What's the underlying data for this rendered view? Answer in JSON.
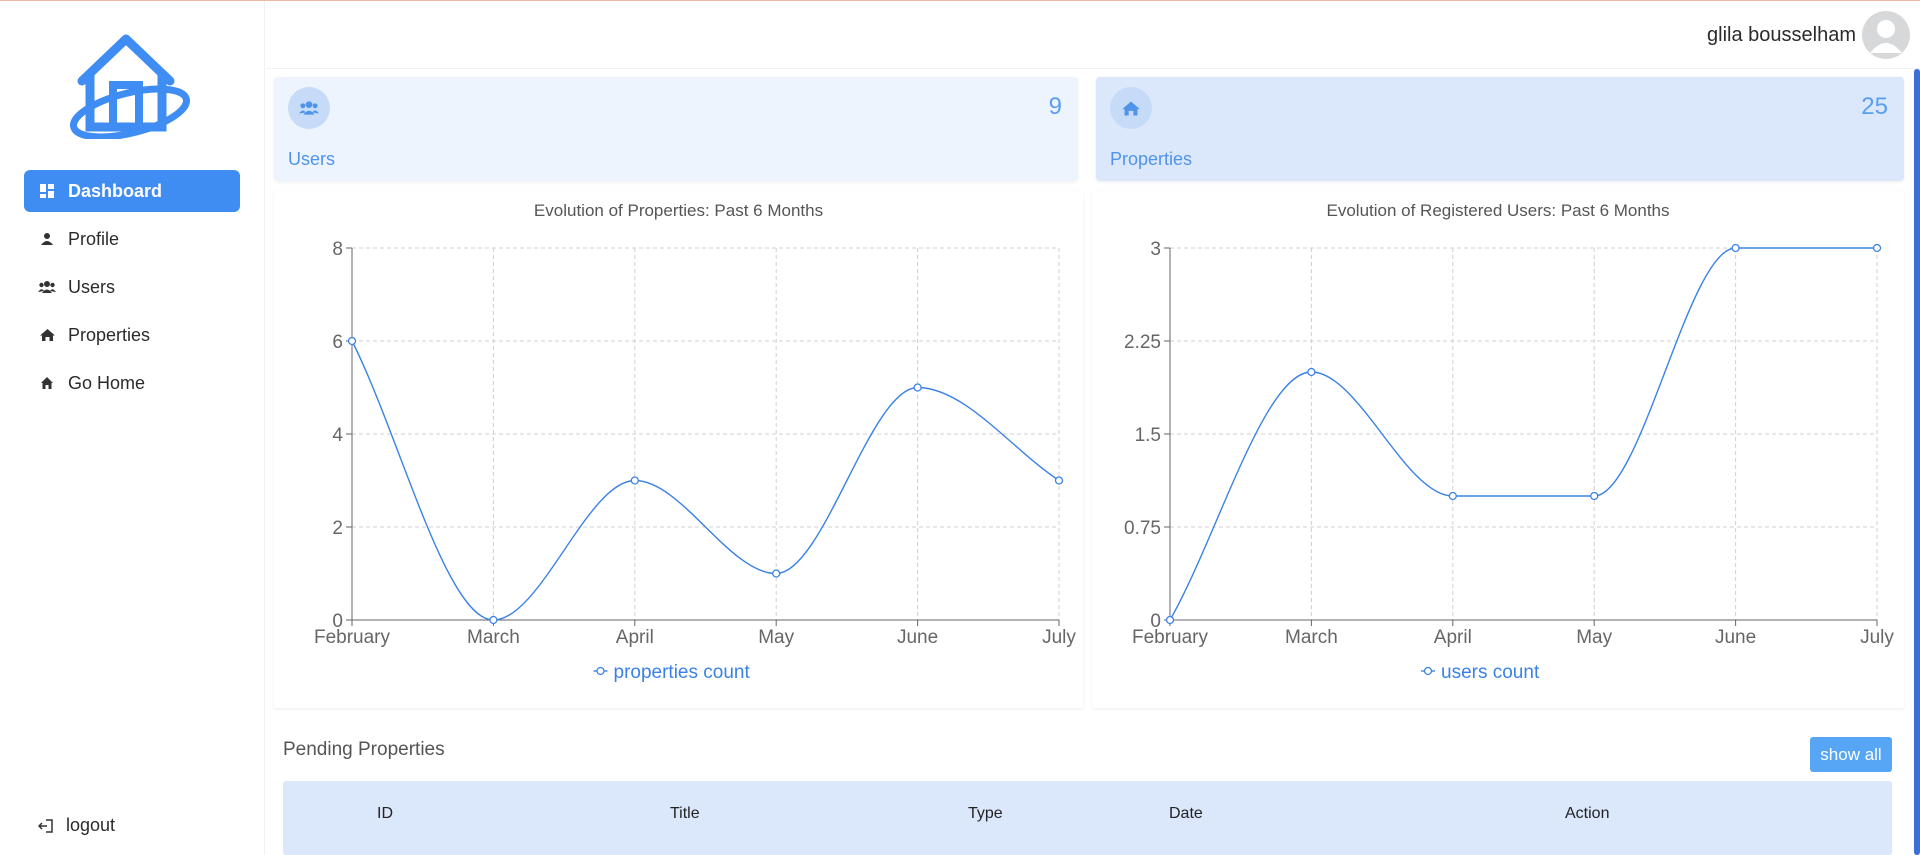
{
  "sidebar": {
    "items": [
      {
        "label": "Dashboard",
        "icon": "dashboard-icon",
        "active": true
      },
      {
        "label": "Profile",
        "icon": "user-icon",
        "active": false
      },
      {
        "label": "Users",
        "icon": "users-icon",
        "active": false
      },
      {
        "label": "Properties",
        "icon": "house-icon",
        "active": false
      },
      {
        "label": "Go Home",
        "icon": "home-icon",
        "active": false
      }
    ],
    "logout_label": "logout"
  },
  "header": {
    "user_name": "glila bousselham"
  },
  "stats": {
    "users": {
      "label": "Users",
      "value": "9"
    },
    "properties": {
      "label": "Properties",
      "value": "25"
    }
  },
  "chart_data": [
    {
      "type": "line",
      "title": "Evolution of Properties: Past 6 Months",
      "categories": [
        "February",
        "March",
        "April",
        "May",
        "June",
        "July"
      ],
      "series": [
        {
          "name": "properties count",
          "values": [
            6,
            0,
            3,
            1,
            5,
            3
          ]
        }
      ],
      "yticks": [
        "0",
        "2",
        "4",
        "6",
        "8"
      ],
      "ylim": [
        0,
        8
      ],
      "grid": true,
      "legend": "bottom",
      "color": "#3b82e6"
    },
    {
      "type": "line",
      "title": "Evolution of Registered Users: Past 6 Months",
      "categories": [
        "February",
        "March",
        "April",
        "May",
        "June",
        "July"
      ],
      "series": [
        {
          "name": "users count",
          "values": [
            0,
            2,
            1,
            1,
            3,
            3
          ]
        }
      ],
      "yticks": [
        "0",
        "0.75",
        "1.5",
        "2.25",
        "3"
      ],
      "ylim": [
        0,
        3
      ],
      "grid": true,
      "legend": "bottom",
      "color": "#3b82e6"
    }
  ],
  "pending": {
    "title": "Pending Properties",
    "show_all_label": "show all",
    "columns": [
      "ID",
      "Title",
      "Type",
      "Date",
      "Action"
    ]
  },
  "colors": {
    "accent": "#3f8cf3",
    "card_light": "#eef4fd",
    "card_blue": "#dbe8fc",
    "line": "#3b82e6"
  }
}
